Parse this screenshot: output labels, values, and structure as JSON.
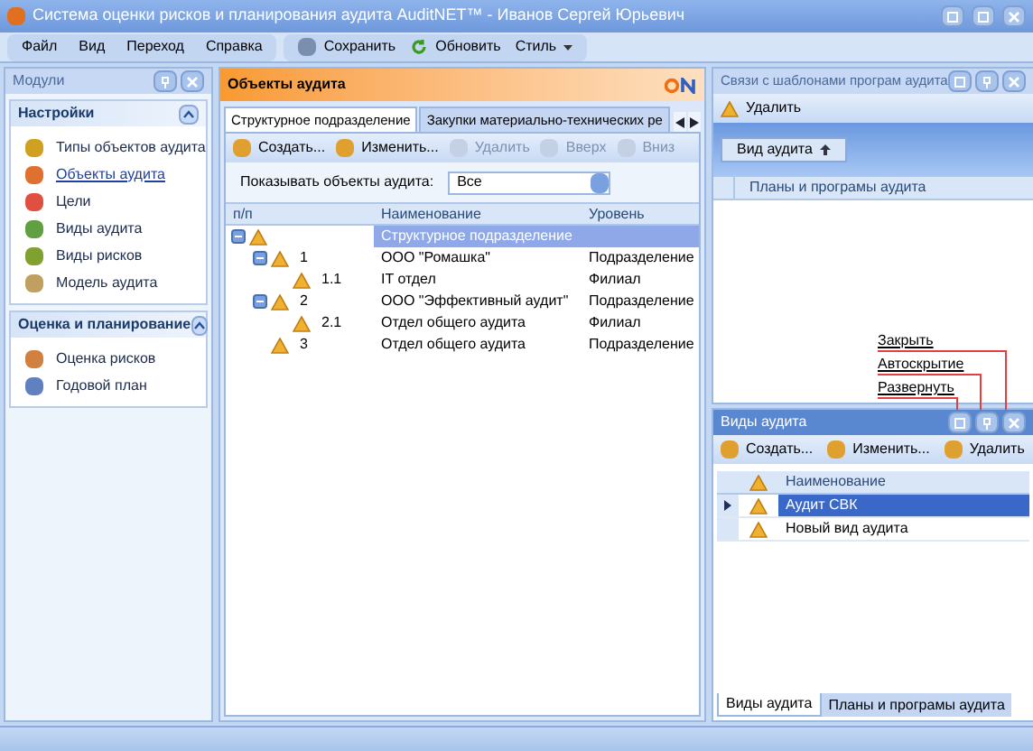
{
  "window": {
    "title": "Система оценки рисков и планирования аудита AuditNET™ - Иванов Сергей Юрьевич"
  },
  "menu": [
    "Файл",
    "Вид",
    "Переход",
    "Справка"
  ],
  "toolbar": [
    {
      "label": "Сохранить",
      "kind": "save"
    },
    {
      "label": "Обновить",
      "kind": "refresh"
    },
    {
      "label": "Стиль",
      "kind": "dropdown"
    }
  ],
  "sidebar": {
    "title": "Модули",
    "groups": [
      {
        "title": "Настройки",
        "expanded": true,
        "items": [
          {
            "label": "Типы объектов аудита",
            "selected": false
          },
          {
            "label": "Объекты аудита",
            "selected": true
          },
          {
            "label": "Цели",
            "selected": false
          },
          {
            "label": "Виды аудита",
            "selected": false
          },
          {
            "label": "Виды рисков",
            "selected": false
          },
          {
            "label": "Модель аудита",
            "selected": false
          }
        ]
      },
      {
        "title": "Оценка и планирование",
        "expanded": true,
        "items": [
          {
            "label": "Оценка рисков",
            "selected": false
          },
          {
            "label": "Годовой план",
            "selected": false
          }
        ]
      }
    ]
  },
  "main": {
    "title": "Объекты аудита",
    "tabs": [
      {
        "label": "Структурное подразделение",
        "selected": true
      },
      {
        "label": "Закупки материально-технических ре",
        "selected": false
      }
    ],
    "actions": [
      {
        "label": "Создать...",
        "disabled": false
      },
      {
        "label": "Изменить...",
        "disabled": false
      },
      {
        "label": "Удалить",
        "disabled": true
      },
      {
        "label": "Вверх",
        "disabled": true
      },
      {
        "label": "Вниз",
        "disabled": true
      }
    ],
    "filter": {
      "label": "Показывать объекты аудита:",
      "value": "Все"
    },
    "tree": {
      "columns": [
        "п/п",
        "Наименование",
        "Уровень"
      ],
      "rows": [
        {
          "number": "",
          "name": "Структурное подразделение",
          "level_name": "",
          "selected": true,
          "expanded": true,
          "children": [
            {
              "number": "1",
              "name": "ООО \"Ромашка\"",
              "level_name": "Подразделение",
              "selected": false,
              "expanded": true,
              "children": [
                {
                  "number": "1.1",
                  "name": "IT отдел",
                  "level_name": "Филиал",
                  "selected": false
                }
              ]
            },
            {
              "number": "2",
              "name": "ООО \"Эффективный аудит\"",
              "level_name": "Подразделение",
              "selected": false,
              "expanded": true,
              "children": [
                {
                  "number": "2.1",
                  "name": "Отдел общего аудита",
                  "level_name": "Филиал",
                  "selected": false
                }
              ]
            },
            {
              "number": "3",
              "name": "Отдел общего аудита",
              "level_name": "Подразделение",
              "selected": false
            }
          ]
        }
      ]
    }
  },
  "links_panel": {
    "title": "Связи с шаблонами програм аудита",
    "delete": "Удалить",
    "group_chip": "Вид аудита",
    "column": "Планы и програмы аудита"
  },
  "annotations": [
    "Закрыть",
    "Автоскрытие",
    "Развернуть"
  ],
  "types_panel": {
    "title": "Виды аудита",
    "actions": [
      "Создать...",
      "Изменить...",
      "Удалить"
    ],
    "column": "Наименование",
    "rows": [
      {
        "name": "Аудит СВК",
        "selected": true
      },
      {
        "name": "Новый вид аудита",
        "selected": false
      }
    ],
    "tabs": [
      {
        "label": "Виды аудита",
        "selected": true
      },
      {
        "label": "Планы и програмы аудита",
        "selected": false
      }
    ]
  }
}
